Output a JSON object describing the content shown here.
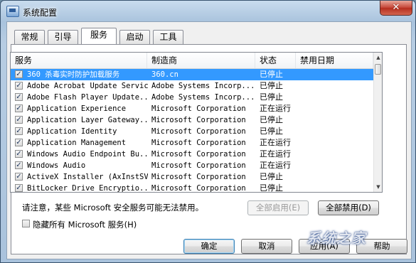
{
  "window": {
    "title": "系统配置",
    "close_label": "✕"
  },
  "tabs": [
    {
      "label": "常规",
      "active": false
    },
    {
      "label": "引导",
      "active": false
    },
    {
      "label": "服务",
      "active": true
    },
    {
      "label": "启动",
      "active": false
    },
    {
      "label": "工具",
      "active": false
    }
  ],
  "services_list": {
    "columns": [
      "服务",
      "制造商",
      "状态",
      "禁用日期"
    ],
    "rows": [
      {
        "name": "360 杀毒实时防护加载服务",
        "maker": "360.cn",
        "status": "已停止",
        "checked": true,
        "selected": true
      },
      {
        "name": "Adobe Acrobat Update Service",
        "maker": "Adobe Systems Incorp...",
        "status": "已停止",
        "checked": true
      },
      {
        "name": "Adobe Flash Player Update...",
        "maker": "Adobe Systems Incorp...",
        "status": "已停止",
        "checked": true
      },
      {
        "name": "Application Experience",
        "maker": "Microsoft Corporation",
        "status": "正在运行",
        "checked": true
      },
      {
        "name": "Application Layer Gateway...",
        "maker": "Microsoft Corporation",
        "status": "已停止",
        "checked": true
      },
      {
        "name": "Application Identity",
        "maker": "Microsoft Corporation",
        "status": "已停止",
        "checked": true
      },
      {
        "name": "Application Management",
        "maker": "Microsoft Corporation",
        "status": "正在运行",
        "checked": true
      },
      {
        "name": "Windows Audio Endpoint Bu...",
        "maker": "Microsoft Corporation",
        "status": "正在运行",
        "checked": true
      },
      {
        "name": "Windows Audio",
        "maker": "Microsoft Corporation",
        "status": "正在运行",
        "checked": true
      },
      {
        "name": "ActiveX Installer (AxInstSV)",
        "maker": "Microsoft Corporation",
        "status": "已停止",
        "checked": true
      },
      {
        "name": "BitLocker Drive Encryptio...",
        "maker": "Microsoft Corporation",
        "status": "已停止",
        "checked": true
      }
    ]
  },
  "note": "请注意，某些 Microsoft 安全服务可能无法禁用。",
  "buttons": {
    "enable_all": "全部启用(E)",
    "disable_all": "全部禁用(D)",
    "ok": "确定",
    "cancel": "取消",
    "apply": "应用(A)",
    "help": "帮助"
  },
  "hide_ms": {
    "label": "隐藏所有 Microsoft 服务(H)",
    "checked": false
  },
  "watermark": "系统之家",
  "colors": {
    "selection": "#3399ff",
    "close_button": "#c6483a"
  }
}
